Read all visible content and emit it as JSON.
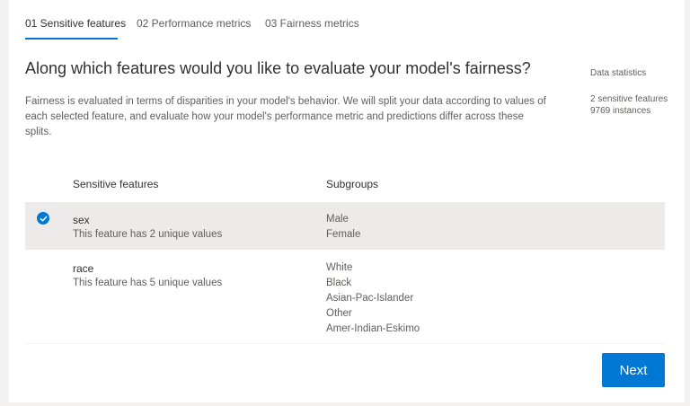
{
  "tabs": [
    {
      "label": "01 Sensitive features",
      "active": true
    },
    {
      "label": "02 Performance metrics",
      "active": false
    },
    {
      "label": "03 Fairness metrics",
      "active": false
    }
  ],
  "title": "Along which features would you like to evaluate your model's fairness?",
  "description": "Fairness is evaluated in terms of disparities in your model's behavior. We will split your data according to values of each selected feature, and evaluate how your model's performance metric and predictions differ across these splits.",
  "stats": {
    "label": "Data statistics",
    "sensitive_features": "2 sensitive features",
    "instances": "9769 instances"
  },
  "table": {
    "headers": {
      "feature": "Sensitive features",
      "subgroups": "Subgroups"
    },
    "rows": [
      {
        "name": "sex",
        "detail": "This feature has 2 unique values",
        "selected": true,
        "subgroups": [
          "Male",
          "Female"
        ]
      },
      {
        "name": "race",
        "detail": "This feature has 5 unique values",
        "selected": false,
        "subgroups": [
          "White",
          "Black",
          "Asian-Pac-Islander",
          "Other",
          "Amer-Indian-Eskimo"
        ]
      }
    ]
  },
  "next_button": {
    "label": "Next"
  },
  "colors": {
    "accent": "#0078d4",
    "selected_row": "#edebe9"
  },
  "icons": {
    "selected_row": "checkmark-circle-icon"
  }
}
